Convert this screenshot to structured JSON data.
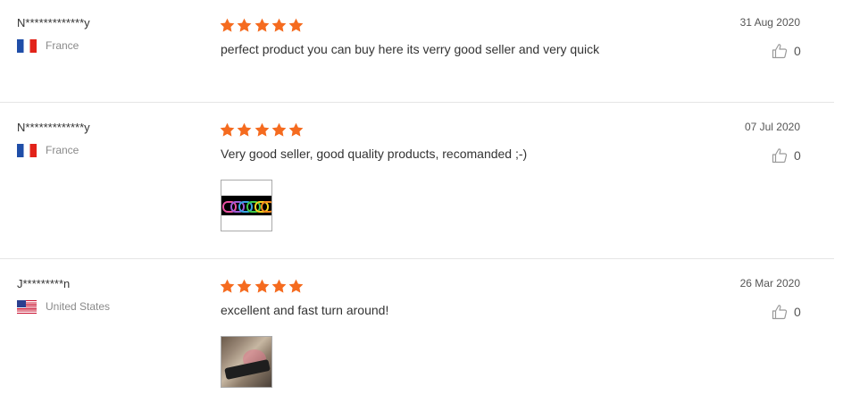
{
  "colors": {
    "star": "#f56b1f",
    "divider": "#e5e5e5"
  },
  "reviews": [
    {
      "user": "N*************y",
      "country": "France",
      "flag_icon": "flag-france-icon",
      "rating": 5,
      "text": "perfect product you can buy here its verry good seller and very quick",
      "date": "31 Aug 2020",
      "helpful_count": "0"
    },
    {
      "user": "N*************y",
      "country": "France",
      "flag_icon": "flag-france-icon",
      "rating": 5,
      "text": "Very good seller, good quality products, recomanded ;-)",
      "date": "07 Jul 2020",
      "helpful_count": "0",
      "photo": "bracelets-photo"
    },
    {
      "user": "J*********n",
      "country": "United States",
      "flag_icon": "flag-usa-icon",
      "rating": 5,
      "text": "excellent and fast turn around!",
      "date": "26 Mar 2020",
      "helpful_count": "0",
      "photo": "wristband-photo"
    }
  ]
}
